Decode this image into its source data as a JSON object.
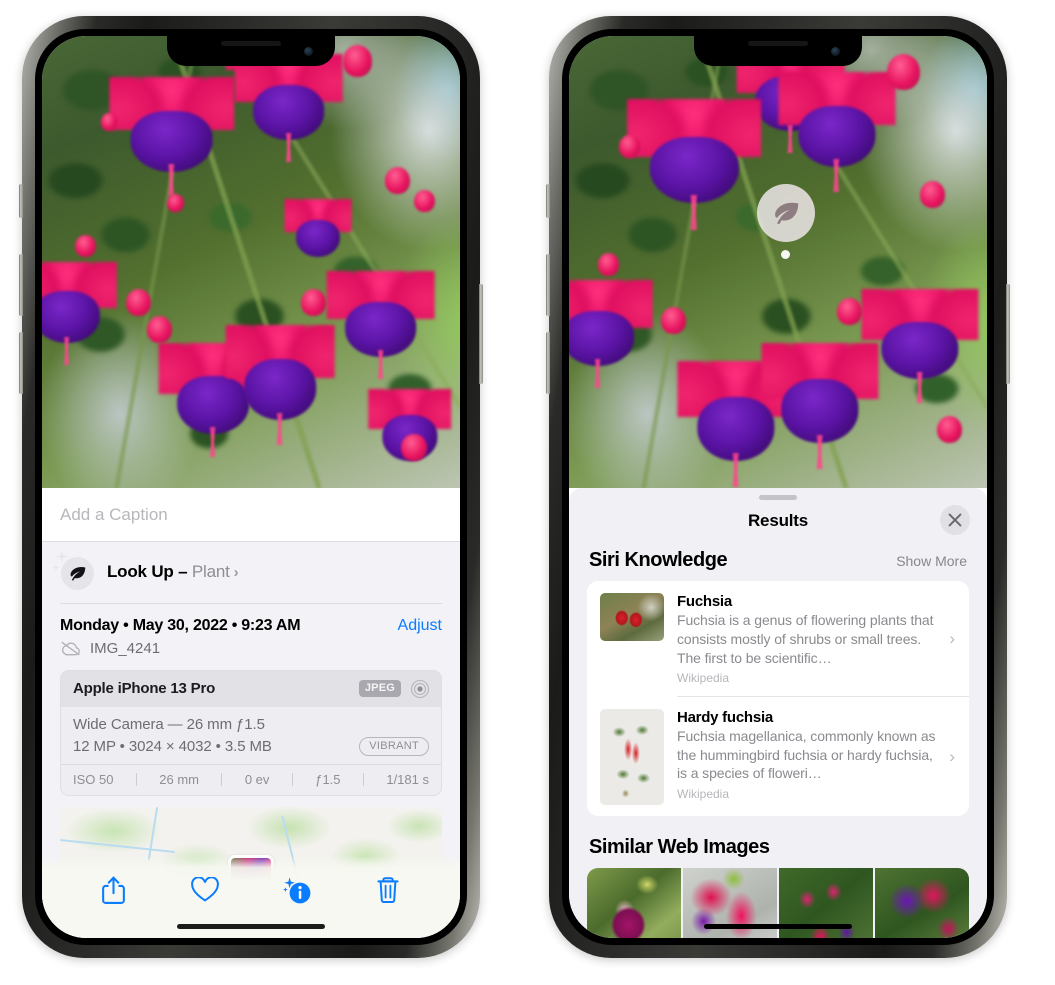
{
  "left_phone": {
    "caption_placeholder": "Add a Caption",
    "lookup": {
      "label": "Look Up – ",
      "subject": "Plant",
      "chevron": "›",
      "icon": "leaf-icon"
    },
    "date": "Monday • May 30, 2022 • 9:23 AM",
    "adjust_label": "Adjust",
    "file_name": "IMG_4241",
    "cloud_icon": "icloud-slash-icon",
    "exif": {
      "device": "Apple iPhone 13 Pro",
      "format_badge": "JPEG",
      "lens_icon": "aperture-icon",
      "lens_line": "Wide Camera — 26 mm ƒ1.5",
      "specs_line": "12 MP • 3024 × 4032 • 3.5 MB",
      "style_badge": "VIBRANT",
      "settings": [
        "ISO 50",
        "26 mm",
        "0 ev",
        "ƒ1.5",
        "1/181 s"
      ]
    },
    "toolbar": [
      {
        "name": "share-button",
        "icon": "share-icon"
      },
      {
        "name": "favorite-button",
        "icon": "heart-icon"
      },
      {
        "name": "info-button",
        "icon": "info-sparkle-icon"
      },
      {
        "name": "delete-button",
        "icon": "trash-icon"
      }
    ]
  },
  "right_phone": {
    "badge_icon": "leaf-icon",
    "sheet": {
      "title": "Results",
      "close_icon": "close-icon",
      "siri_section": {
        "title": "Siri Knowledge",
        "show_more": "Show More",
        "items": [
          {
            "title": "Fuchsia",
            "description": "Fuchsia is a genus of flowering plants that consists mostly of shrubs or small trees. The first to be scientific…",
            "source": "Wikipedia",
            "chevron": "›"
          },
          {
            "title": "Hardy fuchsia",
            "description": "Fuchsia magellanica, commonly known as the hummingbird fuchsia or hardy fuchsia, is a species of floweri…",
            "source": "Wikipedia",
            "chevron": "›"
          }
        ]
      },
      "web_section": {
        "title": "Similar Web Images",
        "thumbnails": [
          "fuchsia-web-image-1",
          "fuchsia-web-image-2",
          "fuchsia-web-image-3",
          "fuchsia-web-image-4"
        ]
      }
    }
  },
  "colors": {
    "accent_blue": "#0a7cff",
    "sheet_bg": "#f1f1f5",
    "card_bg": "#ffffff",
    "secondary_text": "#8e8e93"
  }
}
